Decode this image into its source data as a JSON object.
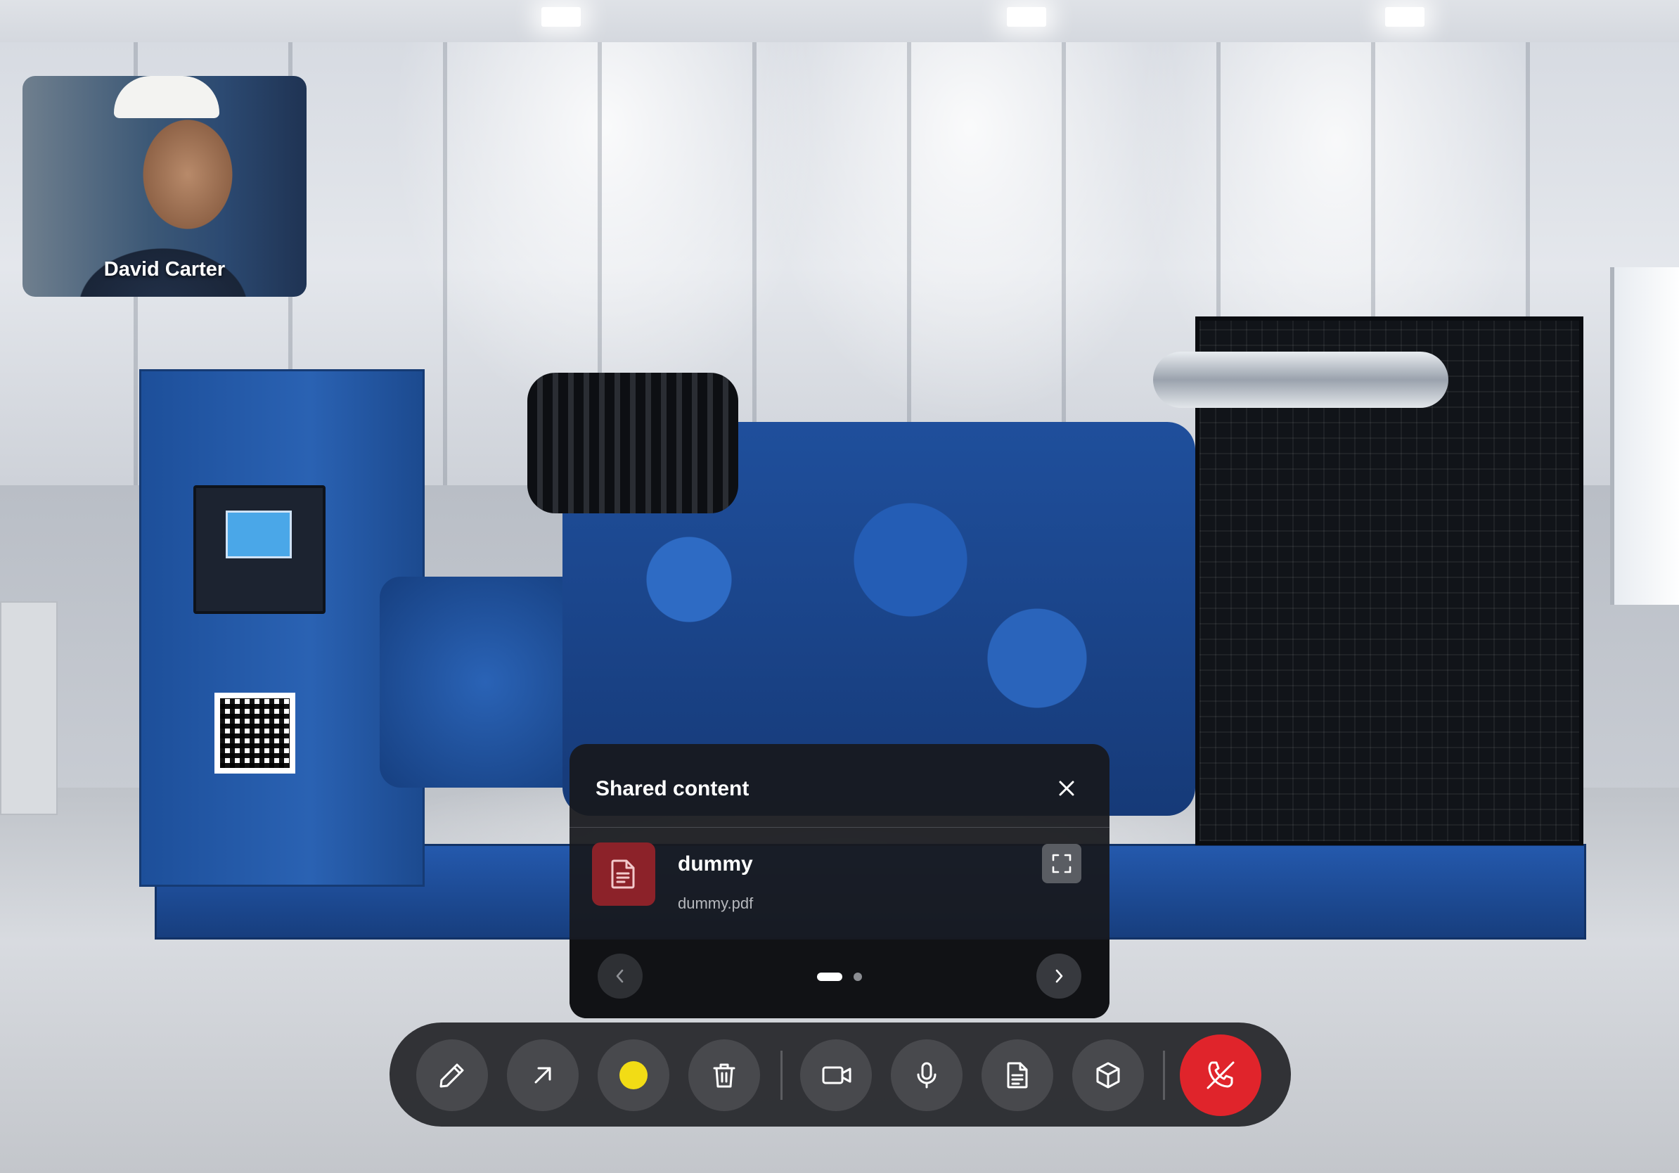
{
  "participant": {
    "name": "David Carter"
  },
  "shared_content": {
    "title": "Shared content",
    "file": {
      "name": "dummy",
      "filename": "dummy.pdf"
    },
    "pagination": {
      "total_pages": 2,
      "current_page": 1
    }
  },
  "toolbar": {
    "tools": [
      "pen-icon",
      "arrow-icon",
      "color-picker",
      "trash-icon",
      "video-icon",
      "microphone-icon",
      "document-icon",
      "cube-icon",
      "end-call-icon"
    ],
    "selected_color": "#f2dc15",
    "end_call_color": "#e0242b"
  }
}
